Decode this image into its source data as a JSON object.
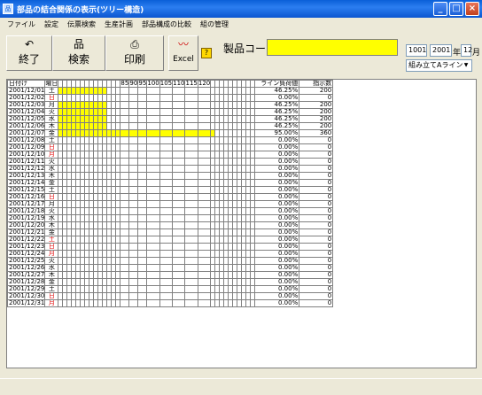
{
  "window": {
    "title": "部品の結合関係の表示(ツリー構造)"
  },
  "menu": [
    "ファイル",
    "設定",
    "伝票検索",
    "生産計画",
    "部品構成の比較",
    "組の管理"
  ],
  "toolbar": {
    "exit_label": "終了",
    "search_label": "検索",
    "print_label": "印刷",
    "excel_label": "Excel",
    "product_code_label": "製品コード",
    "product_code_value": "",
    "code_value": "1001",
    "year_value": "2001",
    "year_unit": "年",
    "month_value": "12",
    "month_unit": "月",
    "line_select": "組み立てAライン"
  },
  "grid": {
    "headers": {
      "date": "日付け",
      "day": "曜日",
      "rate": "ライン負荷値",
      "qty": "指示数",
      "scale": [
        "85",
        "90",
        "95",
        "100",
        "105",
        "110",
        "115",
        "120"
      ]
    },
    "rows": [
      {
        "date": "2001/12/01",
        "day": "土",
        "red": false,
        "rate": "46.25%",
        "qty": "200",
        "fill": 0.4625
      },
      {
        "date": "2001/12/02",
        "day": "日",
        "red": true,
        "rate": "0.00%",
        "qty": "0",
        "fill": 0
      },
      {
        "date": "2001/12/03",
        "day": "月",
        "red": false,
        "rate": "46.25%",
        "qty": "200",
        "fill": 0.4625
      },
      {
        "date": "2001/12/04",
        "day": "火",
        "red": false,
        "rate": "46.25%",
        "qty": "200",
        "fill": 0.4625
      },
      {
        "date": "2001/12/05",
        "day": "水",
        "red": false,
        "rate": "46.25%",
        "qty": "200",
        "fill": 0.4625
      },
      {
        "date": "2001/12/06",
        "day": "木",
        "red": false,
        "rate": "46.25%",
        "qty": "200",
        "fill": 0.4625
      },
      {
        "date": "2001/12/07",
        "day": "金",
        "red": false,
        "rate": "95.00%",
        "qty": "360",
        "fill": 0.95
      },
      {
        "date": "2001/12/08",
        "day": "土",
        "red": false,
        "rate": "0.00%",
        "qty": "0",
        "fill": 0
      },
      {
        "date": "2001/12/09",
        "day": "日",
        "red": true,
        "rate": "0.00%",
        "qty": "0",
        "fill": 0
      },
      {
        "date": "2001/12/10",
        "day": "月",
        "red": true,
        "rate": "0.00%",
        "qty": "0",
        "fill": 0
      },
      {
        "date": "2001/12/11",
        "day": "火",
        "red": false,
        "rate": "0.00%",
        "qty": "0",
        "fill": 0
      },
      {
        "date": "2001/12/12",
        "day": "水",
        "red": false,
        "rate": "0.00%",
        "qty": "0",
        "fill": 0
      },
      {
        "date": "2001/12/13",
        "day": "木",
        "red": false,
        "rate": "0.00%",
        "qty": "0",
        "fill": 0
      },
      {
        "date": "2001/12/14",
        "day": "金",
        "red": false,
        "rate": "0.00%",
        "qty": "0",
        "fill": 0
      },
      {
        "date": "2001/12/15",
        "day": "土",
        "red": false,
        "rate": "0.00%",
        "qty": "0",
        "fill": 0
      },
      {
        "date": "2001/12/16",
        "day": "日",
        "red": true,
        "rate": "0.00%",
        "qty": "0",
        "fill": 0
      },
      {
        "date": "2001/12/17",
        "day": "月",
        "red": false,
        "rate": "0.00%",
        "qty": "0",
        "fill": 0
      },
      {
        "date": "2001/12/18",
        "day": "火",
        "red": false,
        "rate": "0.00%",
        "qty": "0",
        "fill": 0
      },
      {
        "date": "2001/12/19",
        "day": "水",
        "red": false,
        "rate": "0.00%",
        "qty": "0",
        "fill": 0
      },
      {
        "date": "2001/12/20",
        "day": "木",
        "red": false,
        "rate": "0.00%",
        "qty": "0",
        "fill": 0
      },
      {
        "date": "2001/12/21",
        "day": "金",
        "red": false,
        "rate": "0.00%",
        "qty": "0",
        "fill": 0
      },
      {
        "date": "2001/12/22",
        "day": "土",
        "red": true,
        "rate": "0.00%",
        "qty": "0",
        "fill": 0
      },
      {
        "date": "2001/12/23",
        "day": "日",
        "red": true,
        "rate": "0.00%",
        "qty": "0",
        "fill": 0
      },
      {
        "date": "2001/12/24",
        "day": "月",
        "red": true,
        "rate": "0.00%",
        "qty": "0",
        "fill": 0
      },
      {
        "date": "2001/12/25",
        "day": "火",
        "red": false,
        "rate": "0.00%",
        "qty": "0",
        "fill": 0
      },
      {
        "date": "2001/12/26",
        "day": "水",
        "red": false,
        "rate": "0.00%",
        "qty": "0",
        "fill": 0
      },
      {
        "date": "2001/12/27",
        "day": "木",
        "red": false,
        "rate": "0.00%",
        "qty": "0",
        "fill": 0
      },
      {
        "date": "2001/12/28",
        "day": "金",
        "red": false,
        "rate": "0.00%",
        "qty": "0",
        "fill": 0
      },
      {
        "date": "2001/12/29",
        "day": "土",
        "red": false,
        "rate": "0.00%",
        "qty": "0",
        "fill": 0
      },
      {
        "date": "2001/12/30",
        "day": "日",
        "red": true,
        "rate": "0.00%",
        "qty": "0",
        "fill": 0
      },
      {
        "date": "2001/12/31",
        "day": "月",
        "red": true,
        "rate": "0.00%",
        "qty": "0",
        "fill": 0
      }
    ]
  },
  "icons": {
    "app": "app-icon",
    "exit": "undo-arrow-icon",
    "search": "tree-icon",
    "print": "printer-icon",
    "excel": "chart-icon",
    "help": "help-icon"
  }
}
